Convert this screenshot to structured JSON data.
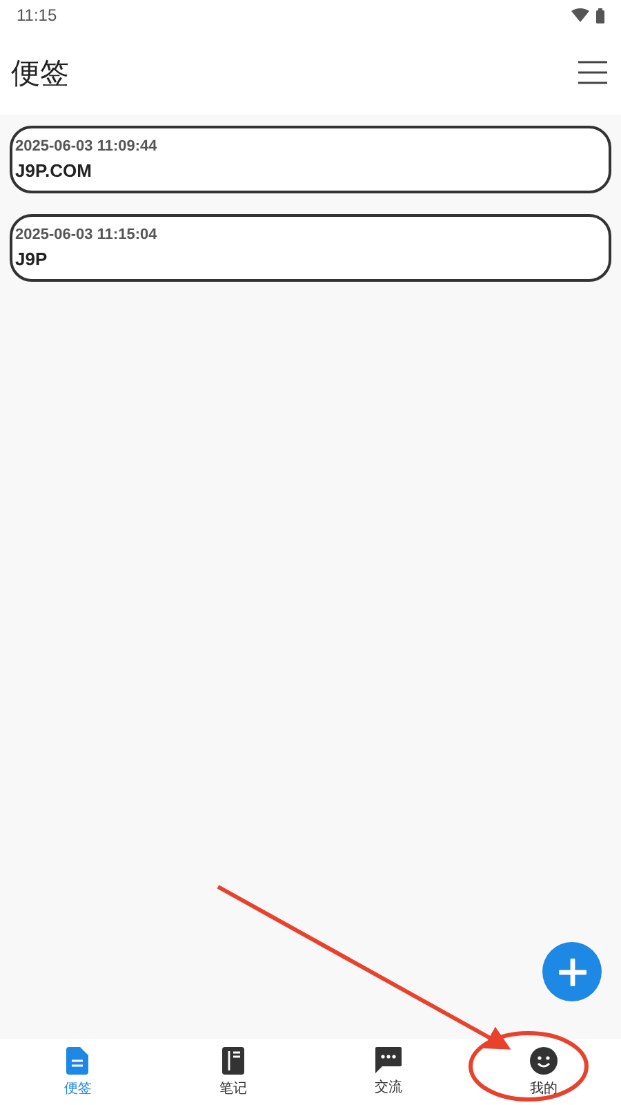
{
  "status_bar": {
    "time": "11:15"
  },
  "header": {
    "title": "便签"
  },
  "notes": [
    {
      "timestamp": "2025-06-03 11:09:44",
      "text": "J9P.COM"
    },
    {
      "timestamp": "2025-06-03 11:15:04",
      "text": "J9P"
    }
  ],
  "bottom_nav": [
    {
      "kind": "note",
      "label": "便签",
      "selected": true
    },
    {
      "kind": "notebook",
      "label": "笔记",
      "selected": false
    },
    {
      "kind": "chat",
      "label": "交流",
      "selected": false
    },
    {
      "kind": "profile",
      "label": "我的",
      "selected": false
    }
  ]
}
